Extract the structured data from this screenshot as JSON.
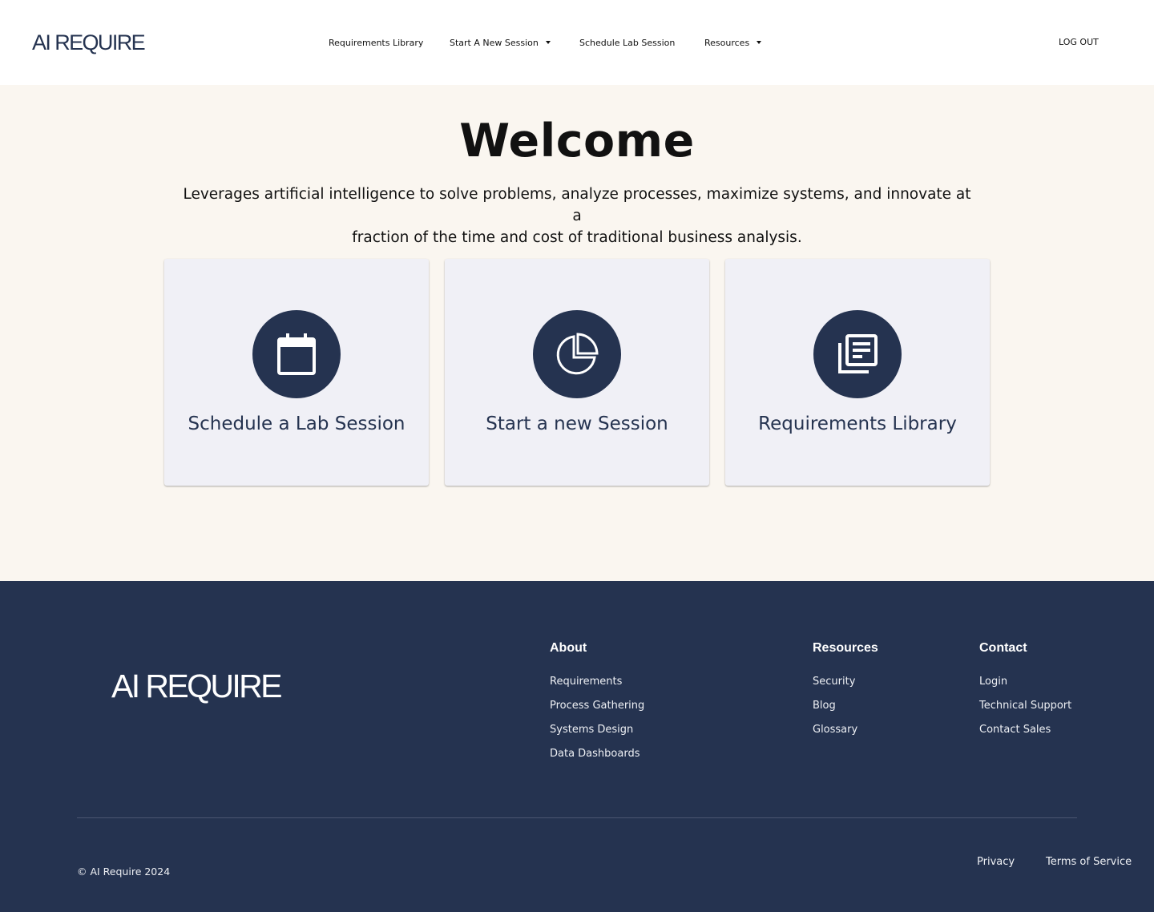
{
  "header": {
    "logo": "AI REQUIRE",
    "nav": [
      {
        "label": "Requirements Library"
      },
      {
        "label": "Start A New Session"
      },
      {
        "label": "Schedule Lab Session"
      },
      {
        "label": "Resources"
      }
    ],
    "logout": "LOG OUT"
  },
  "hero": {
    "title": "Welcome",
    "subtitle_line1": "Leverages artificial intelligence to solve problems, analyze processes, maximize systems, and innovate at a",
    "subtitle_line2": "fraction of the time and cost of traditional business analysis."
  },
  "cards": [
    {
      "title": "Schedule a Lab Session",
      "icon": "calendar-icon"
    },
    {
      "title": "Start a new Session",
      "icon": "pie-chart-icon"
    },
    {
      "title": "Requirements Library",
      "icon": "library-books-icon"
    }
  ],
  "footer": {
    "logo": "AI REQUIRE",
    "about": {
      "heading": "About",
      "links": [
        "Requirements",
        "Process Gathering",
        "Systems Design",
        "Data Dashboards"
      ]
    },
    "resources": {
      "heading": "Resources",
      "links": [
        "Security",
        "Blog",
        "Glossary"
      ]
    },
    "contact": {
      "heading": "Contact",
      "links": [
        "Login",
        "Technical Support",
        "Contact Sales"
      ]
    },
    "copyright": "© AI Require 2024",
    "privacy": "Privacy",
    "terms": "Terms of Service"
  },
  "colors": {
    "navy": "#253350",
    "cream": "#faf6f0",
    "card": "#f0f0f6"
  }
}
